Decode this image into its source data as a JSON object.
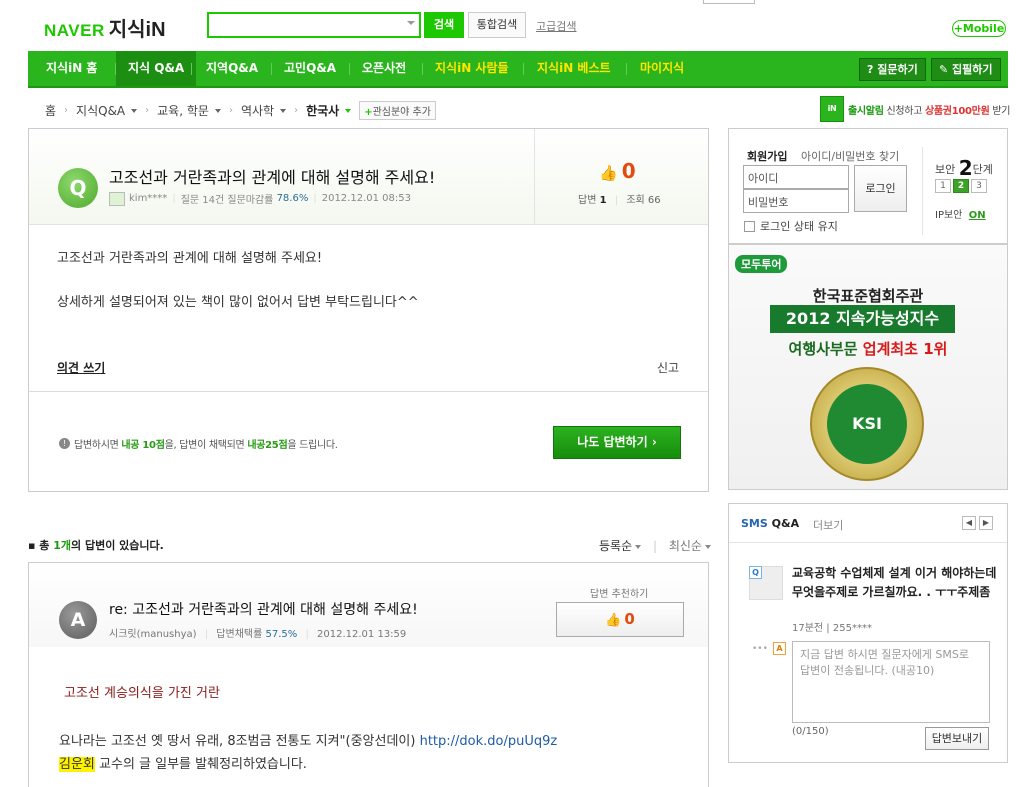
{
  "header": {
    "logo_naver": "NAVER",
    "logo_service": "지식iN",
    "search_value": "",
    "search_button": "검색",
    "total_search_button": "통합검색",
    "advanced_search_link": "고급검색",
    "mobile_button": "+Mobile"
  },
  "nav": {
    "items": [
      "지식iN 홈",
      "지식 Q&A",
      "지역Q&A",
      "고민Q&A",
      "오픈사전",
      "지식iN 사람들",
      "지식iN 베스트",
      "마이지식"
    ],
    "ask_button": "? 질문하기",
    "collect_button": "✎ 집필하기"
  },
  "breadcrumb": {
    "items": [
      "홈",
      "지식Q&A",
      "교육, 학문",
      "역사학",
      "한국사"
    ],
    "add_interest": "관심분야 추가"
  },
  "promo": {
    "icon_label": "iN",
    "text_bold": "출시알림",
    "text_middle": "신청하고",
    "text_red": "상품권100만원",
    "text_end": "받기"
  },
  "question": {
    "badge": "Q",
    "title": "고조선과 거란족과의 관계에 대해 설명해 주세요!",
    "author": "kim****",
    "stats_text": "질문 14건 질문마감률",
    "close_rate": "78.6%",
    "date": "2012.12.01 08:53",
    "likes": "0",
    "answers_label": "답변",
    "answers_count": "1",
    "views_label": "조회",
    "views_count": "66",
    "body_line1": "고조선과 거란족과의 관계에 대해 설명해 주세요!",
    "body_line2": "상세하게 설명되어져 있는 책이 많이 없어서 답변 부탁드립니다^^",
    "opinion_link": "의견 쓰기",
    "report_link": "신고",
    "footer_note_1": "답변하시면",
    "footer_note_2": "내공 10점",
    "footer_note_3": "을, 답변이 채택되면",
    "footer_note_4": "내공25점",
    "footer_note_5": "을 드립니다.",
    "answer_button": "나도 답변하기 ›"
  },
  "answers_summary": {
    "prefix": "총",
    "count": "1개",
    "suffix": "의 답변이 있습니다.",
    "sort_registered": "등록순",
    "sort_latest": "최신순"
  },
  "answer": {
    "badge": "A",
    "title": "re: 고조선과 거란족과의 관계에 대해 설명해 주세요!",
    "author": "시크릿(manushya)",
    "adopt_label": "답변채택률",
    "adopt_rate": "57.5%",
    "date": "2012.12.01 13:59",
    "recommend_label": "답변 추천하기",
    "recommend_count": "0",
    "subtitle": "고조선 계승의식을 가진 거란",
    "line1_text": "요나라는 고조선 옛 땅서 유래, 8조범금 전통도 지켜\"(중앙선데이)",
    "line1_link": "http://dok.do/puUq9z",
    "line2_highlight": "김운회",
    "line2_text": "교수의 글 일부를 발췌정리하였습니다."
  },
  "login": {
    "signup": "회원가입",
    "find": "아이디/비밀번호 찾기",
    "id_placeholder": "아이디",
    "pw_placeholder": "비밀번호",
    "login_button": "로그인",
    "keep_login": "로그인 상태 유지",
    "security_prefix": "보안",
    "security_level": "2",
    "security_suffix": "단계",
    "levels": [
      "1",
      "2",
      "3"
    ],
    "ip_label": "IP보안",
    "ip_state": "ON"
  },
  "ad": {
    "brand": "모두투어",
    "line1": "한국표준협회주관",
    "line2": "2012 지속가능성지수",
    "line3_a": "여행사부문",
    "line3_b": "업계최초 1위",
    "seal": "KSI"
  },
  "sms": {
    "title_a": "SMS",
    "title_b": " Q&A",
    "more": "더보기",
    "prev": "◀",
    "next": "▶",
    "q_tag": "Q",
    "question": "교육공학 수업체제 설계 이거 해야하는데 무엇을주제로 가르칠까요. . ㅜㅜ주제좀",
    "meta": "17분전  |  255****",
    "a_tag": "A",
    "textarea_placeholder": "지금 답변 하시면 질문자에게 SMS로 답변이 전송됩니다. (내공10)",
    "counter": "(0/150)",
    "send_button": "답변보내기"
  }
}
